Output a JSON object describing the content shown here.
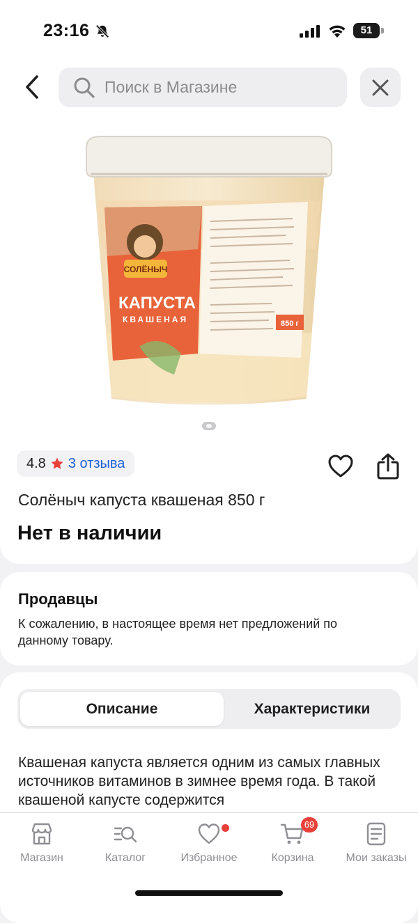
{
  "status_bar": {
    "time": "23:16",
    "battery": "51"
  },
  "search": {
    "placeholder": "Поиск в Магазине",
    "value": ""
  },
  "product": {
    "image_alt_text": "Солёныч капуста квашеная",
    "package_brand": "СОЛЁНЫЧ",
    "package_name_line1": "КАПУСТА",
    "package_name_line2": "КВАШЕНАЯ",
    "package_weight": "850 г",
    "rating": "4.8",
    "reviews": "3 отзыва",
    "title": "Солёныч капуста квашеная 850 г",
    "stock_status": "Нет в наличии"
  },
  "sellers": {
    "title": "Продавцы",
    "text": "К сожалению, в настоящее время нет предложений по данному товару."
  },
  "tabs": {
    "description": "Описание",
    "characteristics": "Характеристики",
    "active": "description"
  },
  "description": {
    "text": "Квашеная капуста является одним из самых главных источников витаминов в зимнее время года. В такой квашеной капусте содержится"
  },
  "bottom_nav": {
    "items": [
      {
        "label": "Магазин",
        "icon": "store-icon"
      },
      {
        "label": "Каталог",
        "icon": "catalog-search-icon"
      },
      {
        "label": "Избранное",
        "icon": "heart-icon"
      },
      {
        "label": "Корзина",
        "icon": "cart-icon",
        "badge": "69"
      },
      {
        "label": "Мои заказы",
        "icon": "orders-icon"
      }
    ]
  },
  "colors": {
    "accent_blue": "#1a5fd8",
    "rating_star": "#e8413a",
    "badge_red": "#e8413a",
    "card_background": "#ffffff",
    "page_background": "#f2f2f4"
  }
}
